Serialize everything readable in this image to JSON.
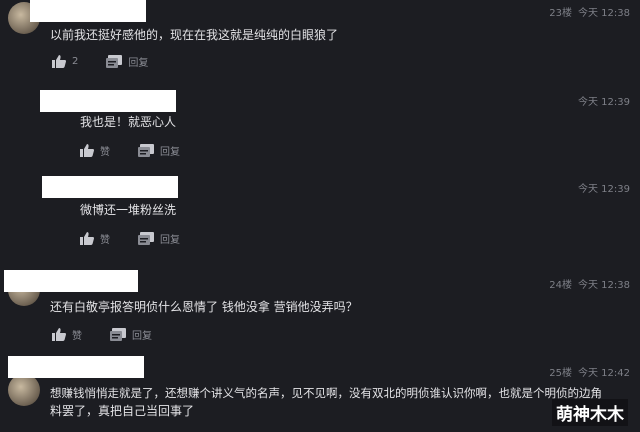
{
  "comments": [
    {
      "floor": "23楼",
      "time": "今天 12:38",
      "text": "以前我还挺好感他的，现在在我这就是纯纯的白眼狼了",
      "like_label": "2",
      "reply_label": "回复"
    },
    {
      "floor": "",
      "time": "今天 12:39",
      "text": "我也是！就恶心人",
      "like_label": "赞",
      "reply_label": "回复"
    },
    {
      "floor": "",
      "time": "今天 12:39",
      "text": "微博还一堆粉丝洗",
      "like_label": "赞",
      "reply_label": "回复"
    },
    {
      "floor": "24楼",
      "time": "今天 12:38",
      "text": "还有白敬亭报答明侦什么恩情了 钱他没拿 营销他没弄吗？",
      "like_label": "赞",
      "reply_label": "回复"
    },
    {
      "floor": "25楼",
      "time": "今天 12:42",
      "text": "想赚钱悄悄走就是了，还想赚个讲义气的名声，见不见啊，没有双北的明侦谁认识你啊，也就是个明侦的边角",
      "text2": "料罢了，真把自己当回事了"
    }
  ],
  "watermark": "萌神木木"
}
